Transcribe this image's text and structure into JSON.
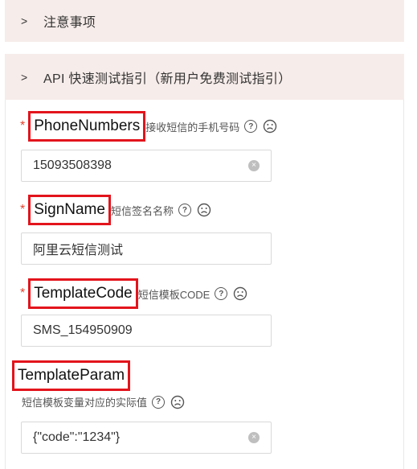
{
  "sections": {
    "notes_title": "注意事项",
    "api_guide_title": "API 快速测试指引（新用户免费测试指引）"
  },
  "fields": [
    {
      "required": "*",
      "name": "PhoneNumbers",
      "desc": "接收短信的手机号码",
      "value": "15093508398"
    },
    {
      "required": "*",
      "name": "SignName",
      "desc": "短信签名名称",
      "value": "阿里云短信测试"
    },
    {
      "required": "*",
      "name": "TemplateCode",
      "desc": "短信模板CODE",
      "value": "SMS_154950909"
    },
    {
      "required": "",
      "name": "TemplateParam",
      "desc": "短信模板变量对应的实际值",
      "value": "{\"code\":\"1234\"}"
    }
  ],
  "icons": {
    "collapse": "chevron-right-icon",
    "hint": "question-circle-icon",
    "feedback": "sad-face-icon",
    "clear": "clear-icon"
  },
  "colors": {
    "section_bg": "#f6ece9",
    "required": "#e3432e",
    "highlight": "#e3141c"
  }
}
